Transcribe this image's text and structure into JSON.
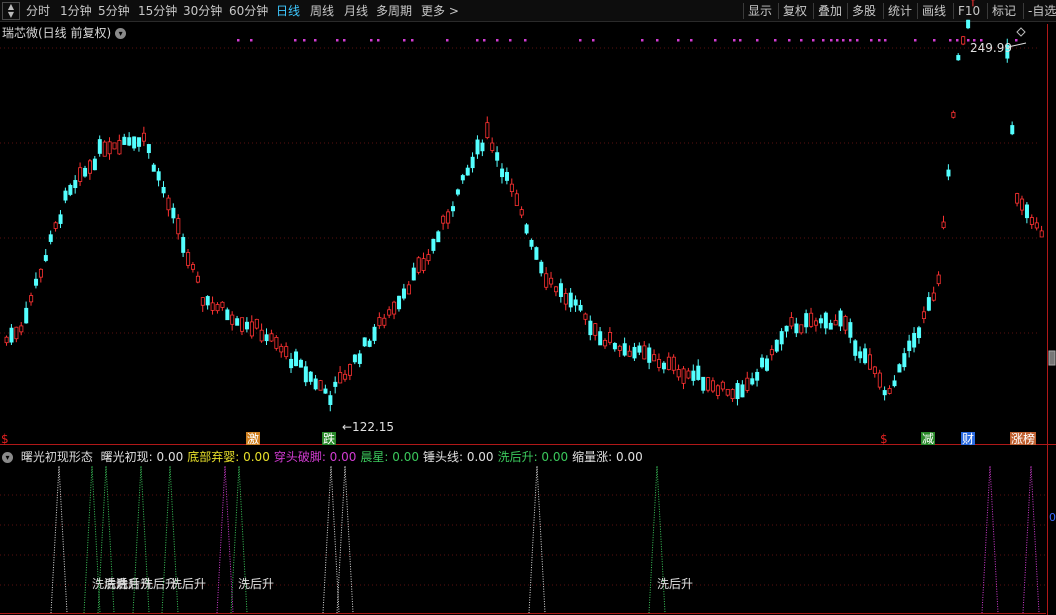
{
  "toolbar": {
    "periods": [
      "分时",
      "1分钟",
      "5分钟",
      "15分钟",
      "30分钟",
      "60分钟",
      "日线",
      "周线",
      "月线",
      "多周期",
      "更多 >"
    ],
    "active": "日线",
    "right_items": [
      "显示",
      "复权",
      "叠加",
      "多股",
      "统计",
      "画线",
      "F10",
      "标记",
      "-自选"
    ]
  },
  "chart": {
    "title": "瑞芯微(日线 前复权)",
    "high_label": "249.99",
    "low_label": "←122.15",
    "bottom_markers": [
      "$",
      "激",
      "跌",
      "$",
      "减",
      "财",
      "涨榜"
    ]
  },
  "indicator": {
    "name": "曙光初现形态",
    "legend": [
      {
        "label": "曙光初现: 0.00",
        "color": "#e0e0e0"
      },
      {
        "label": "底部弃婴: 0.00",
        "color": "#e8e02a"
      },
      {
        "label": "穿头破脚: 0.00",
        "color": "#d23cd2"
      },
      {
        "label": "晨星: 0.00",
        "color": "#3bc85c"
      },
      {
        "label": "锤头线: 0.00",
        "color": "#e0e0e0"
      },
      {
        "label": "洗后升: 0.00",
        "color": "#3bc85c"
      },
      {
        "label": "缩量涨: 0.00",
        "color": "#e0e0e0"
      }
    ],
    "annotations": [
      "洗后升",
      "洗后升",
      "洗后升",
      "洗后升",
      "洗后升",
      "洗后升",
      "洗后升"
    ],
    "axis_label": "0"
  },
  "colors": {
    "up": "#ff3232",
    "down": "#54ffff",
    "magenta": "#d23cd2",
    "green": "#3bc85c",
    "white": "#e0e0e0"
  }
}
